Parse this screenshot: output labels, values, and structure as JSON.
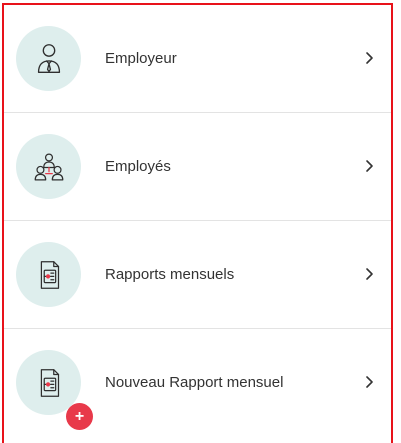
{
  "menu": {
    "items": [
      {
        "label": "Employeur",
        "icon": "employer-icon"
      },
      {
        "label": "Employés",
        "icon": "employees-icon"
      },
      {
        "label": "Rapports mensuels",
        "icon": "report-document-icon"
      },
      {
        "label": "Nouveau Rapport mensuel",
        "icon": "report-document-icon",
        "badge": "+"
      }
    ],
    "chevron_icon": "chevron-right-icon"
  },
  "colors": {
    "frame_border": "#e8121a",
    "icon_circle": "#deeeed",
    "badge": "#e8394a",
    "text": "#333333",
    "divider": "#e3e3e3"
  }
}
